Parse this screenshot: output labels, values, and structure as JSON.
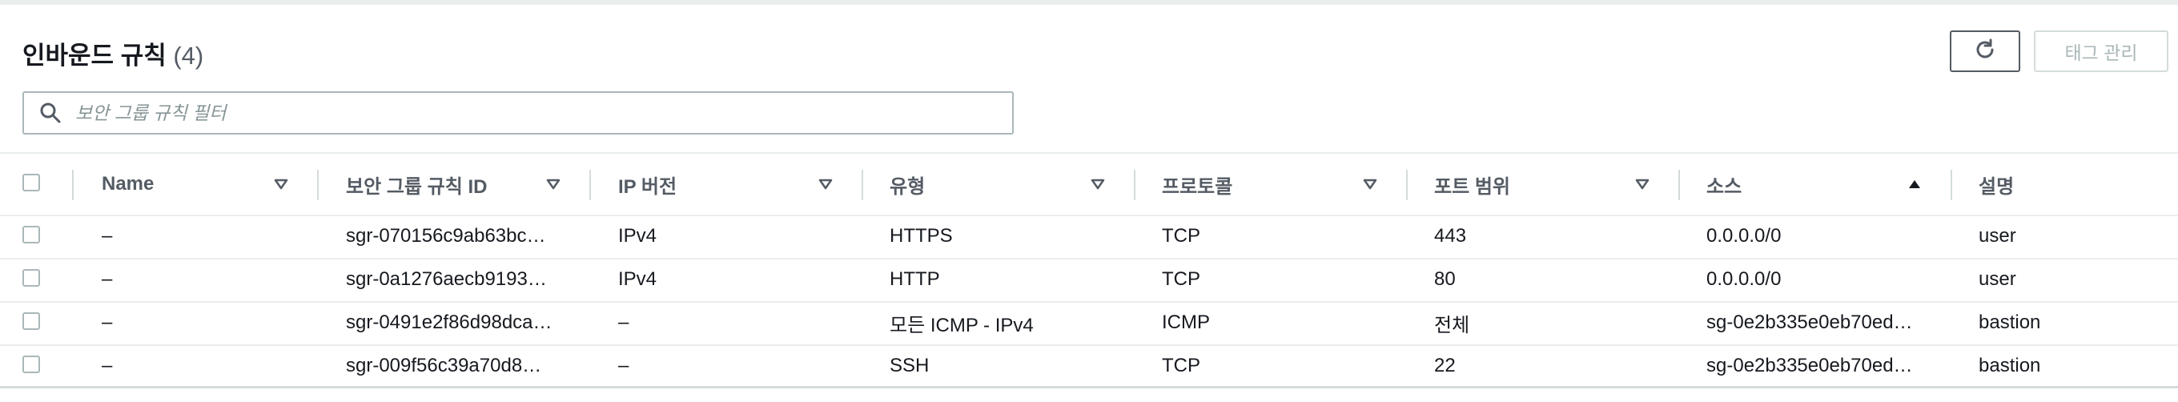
{
  "panel": {
    "title": "인바운드 규칙",
    "count": "(4)",
    "refresh_icon": "refresh-icon",
    "manage_tags_label": "태그 관리",
    "search_placeholder": "보안 그룹 규칙 필터"
  },
  "table": {
    "headers": {
      "name": "Name",
      "rule_id": "보안 그룹 규칙 ID",
      "ip_version": "IP 버전",
      "type": "유형",
      "protocol": "프로토콜",
      "port_range": "포트 범위",
      "source": "소스",
      "description": "설명"
    },
    "sorted_column": "source",
    "sort_direction": "ascending",
    "rows": [
      {
        "name": "–",
        "rule_id": "sgr-070156c9ab63bc…",
        "ip_version": "IPv4",
        "type": "HTTPS",
        "protocol": "TCP",
        "port_range": "443",
        "source": "0.0.0.0/0",
        "description": "user"
      },
      {
        "name": "–",
        "rule_id": "sgr-0a1276aecb9193…",
        "ip_version": "IPv4",
        "type": "HTTP",
        "protocol": "TCP",
        "port_range": "80",
        "source": "0.0.0.0/0",
        "description": "user"
      },
      {
        "name": "–",
        "rule_id": "sgr-0491e2f86d98dca…",
        "ip_version": "–",
        "type": "모든 ICMP - IPv4",
        "protocol": "ICMP",
        "port_range": "전체",
        "source": "sg-0e2b335e0eb70ed…",
        "description": "bastion"
      },
      {
        "name": "–",
        "rule_id": "sgr-009f56c39a70d8…",
        "ip_version": "–",
        "type": "SSH",
        "protocol": "TCP",
        "port_range": "22",
        "source": "sg-0e2b335e0eb70ed…",
        "description": "bastion"
      }
    ]
  },
  "colors": {
    "text": "#16191f",
    "header_text": "#545b64",
    "border": "#eaeded",
    "muted": "#879596"
  }
}
